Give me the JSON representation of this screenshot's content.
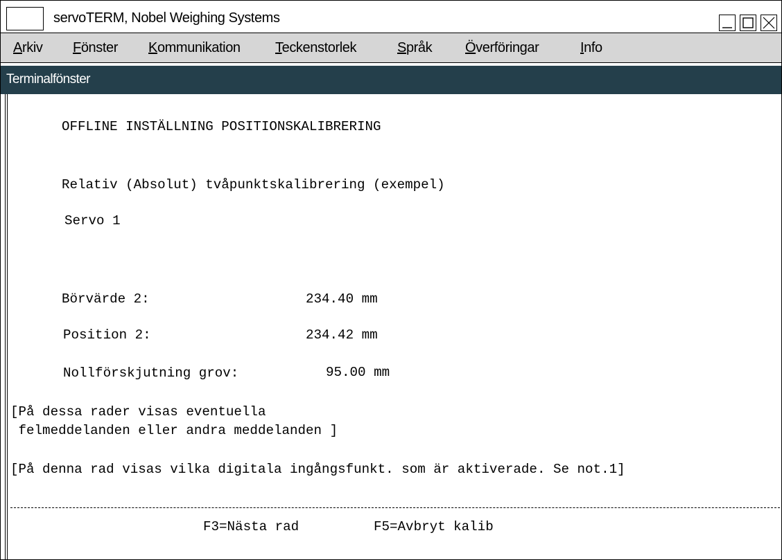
{
  "window": {
    "title": "servoTERM, Nobel Weighing Systems",
    "controls": [
      "minimize-icon",
      "maximize-icon",
      "close-icon"
    ]
  },
  "menu": [
    {
      "mnemonic": "A",
      "rest": "rkiv"
    },
    {
      "mnemonic": "F",
      "rest": "önster"
    },
    {
      "mnemonic": "K",
      "rest": "ommunikation"
    },
    {
      "mnemonic": "T",
      "rest": "eckenstorlek"
    },
    {
      "mnemonic": "S",
      "rest": "pråk"
    },
    {
      "mnemonic": "Ö",
      "rest": "verföringar"
    },
    {
      "mnemonic": "I",
      "rest": "nfo"
    }
  ],
  "panel": {
    "title": "Terminalfönster"
  },
  "terminal": {
    "heading": "OFFLINE INSTÄLLNING POSITIONSKALIBRERING",
    "subheading": "Relativ (Absolut) tvåpunktskalibrering (exempel)",
    "servo": "Servo 1",
    "fields": [
      {
        "label": "Börvärde 2:",
        "value": "234.40 mm"
      },
      {
        "label": "Position 2:",
        "value": "234.42 mm"
      },
      {
        "label": "Nollförskjutning grov:",
        "value": "95.00 mm"
      }
    ],
    "message_line1": "[På dessa rader visas eventuella",
    "message_line2": " felmeddelanden eller andra meddelanden ]",
    "digital_line": "[På denna rad visas vilka digitala ingångsfunkt. som är aktiverade. Se not.1]",
    "f3": "F3=Nästa rad",
    "f5": "F5=Avbryt kalib"
  }
}
